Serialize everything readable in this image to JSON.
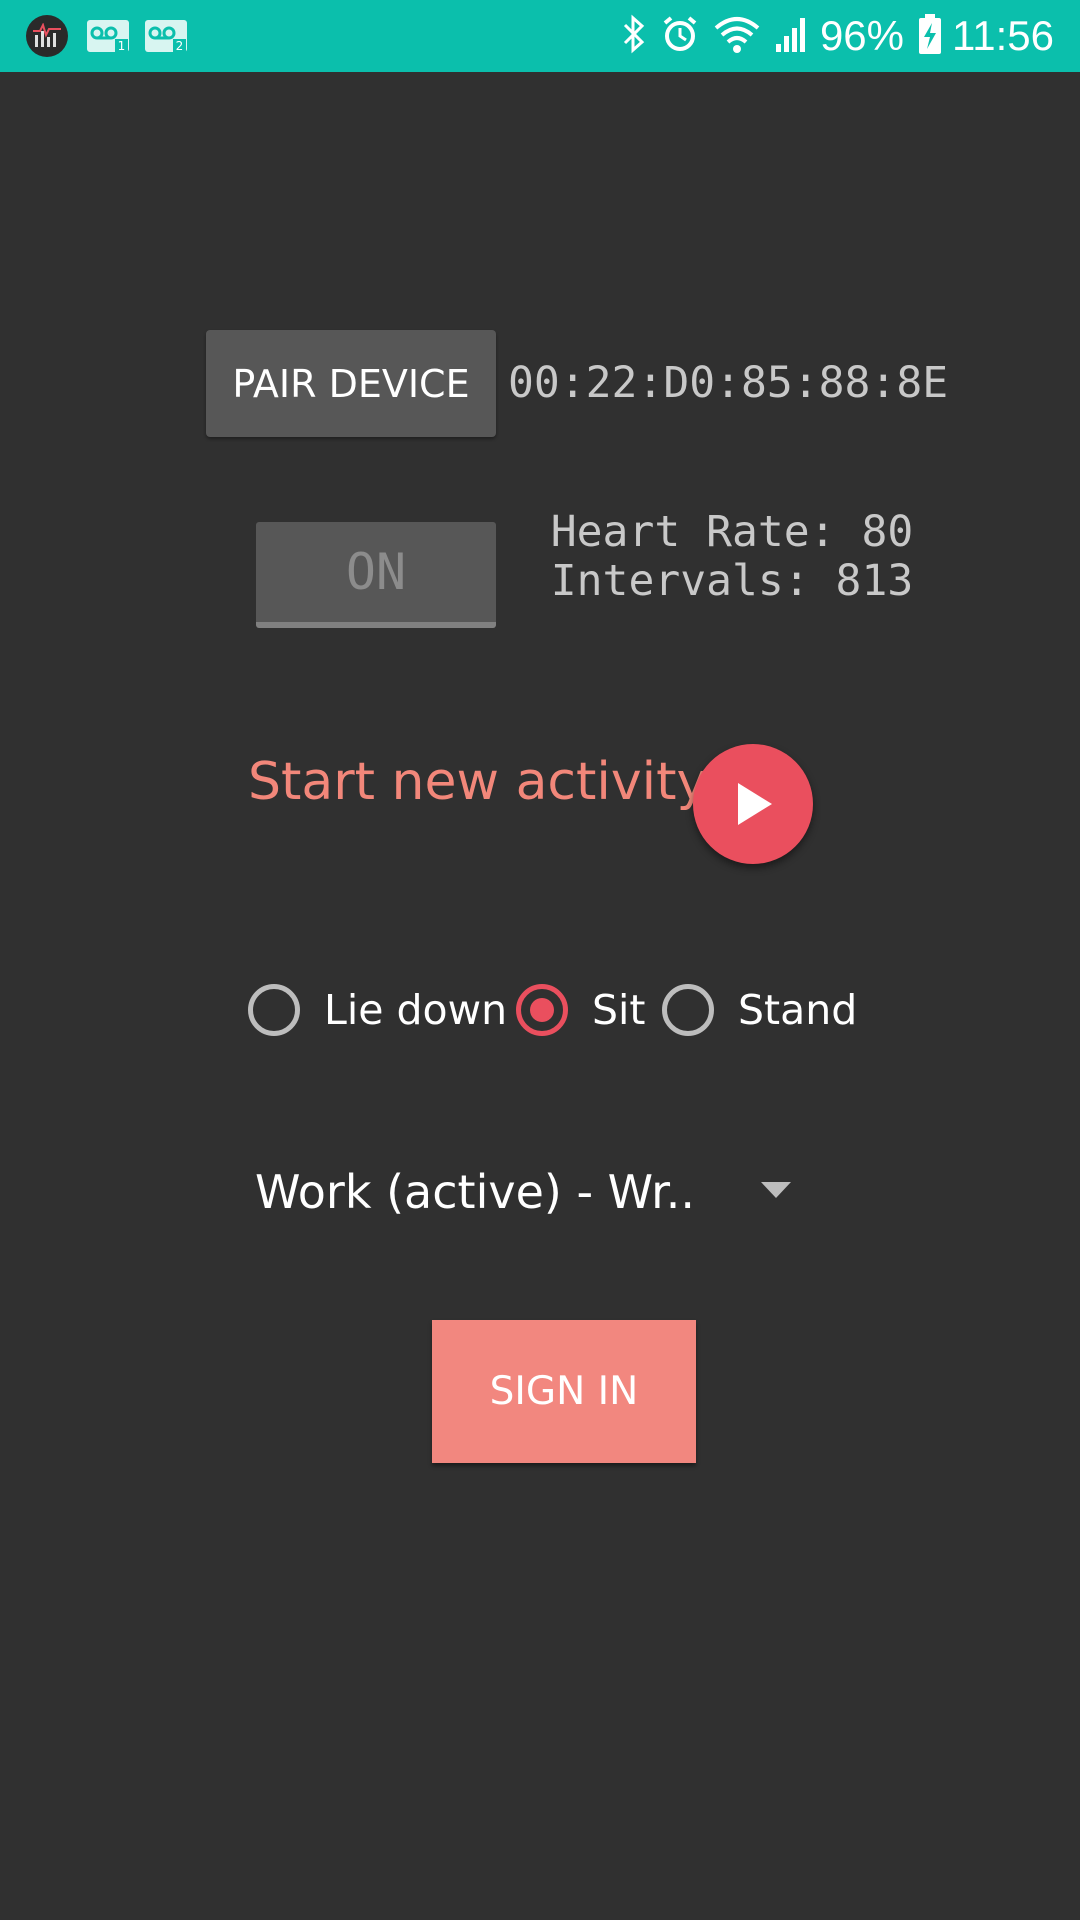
{
  "status_bar": {
    "battery": "96%",
    "time": "11:56",
    "icons": [
      "app-notification-icon",
      "voicemail-1-icon",
      "voicemail-2-icon",
      "bluetooth-icon",
      "alarm-icon",
      "wifi-icon",
      "signal-icon",
      "battery-charging-icon"
    ]
  },
  "device": {
    "pair_label": "PAIR DEVICE",
    "mac_address": "00:22:D0:85:88:8E"
  },
  "monitor": {
    "toggle_label": "ON",
    "heart_rate": "Heart Rate: 80",
    "intervals": "Intervals: 813"
  },
  "activity": {
    "start_label": "Start new activity",
    "play_icon": "play-icon"
  },
  "posture": {
    "options": [
      {
        "label": "Lie down",
        "checked": false
      },
      {
        "label": "Sit",
        "checked": true
      },
      {
        "label": "Stand",
        "checked": false
      }
    ]
  },
  "activity_type": {
    "selected": "Work (active) - Wr.."
  },
  "auth": {
    "signin_label": "SIGN IN"
  },
  "colors": {
    "status_bar": "#0bbfac",
    "background": "#303030",
    "accent": "#ea4f5e",
    "salmon": "#f2877a"
  }
}
